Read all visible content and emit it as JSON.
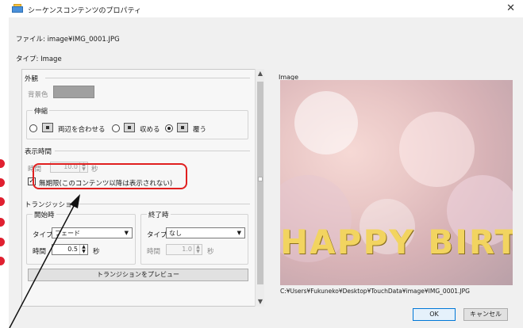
{
  "window": {
    "title": "シーケンスコンテンツのプロパティ",
    "close_glyph": "✕"
  },
  "info": {
    "file": "ファイル:  image¥IMG_0001.JPG",
    "type": "タイプ:  Image"
  },
  "appearance": {
    "title": "外観",
    "bg_color_label": "背景色",
    "stretch_title": "伸縮",
    "options": [
      {
        "label": "両辺を合わせる",
        "icon": "fit-both-icon",
        "selected": false
      },
      {
        "label": "収める",
        "icon": "fit-contain-icon",
        "selected": false
      },
      {
        "label": "覆う",
        "icon": "fit-cover-icon",
        "selected": true
      }
    ]
  },
  "display_time": {
    "title": "表示時間",
    "time_label": "時間",
    "time_value": "10.0",
    "unit": "秒",
    "unlimited_label": "無期限(このコンテンツ以降は表示されない)",
    "unlimited_checked": true
  },
  "transition": {
    "title": "トランジッション",
    "start": {
      "title": "開始時",
      "type_label": "タイプ",
      "type_value": "フェード",
      "time_label": "時間",
      "time_value": "0.5",
      "unit": "秒"
    },
    "end": {
      "title": "終了時",
      "type_label": "タイプ",
      "type_value": "なし",
      "time_label": "時間",
      "time_value": "1.0",
      "unit": "秒"
    },
    "preview_button": "トランジションをプレビュー"
  },
  "preview": {
    "label": "Image",
    "banner": "HAPPY BIRTHDAY",
    "path": "C:¥Users¥Fukuneko¥Desktop¥TouchData¥image¥IMG_0001.JPG"
  },
  "buttons": {
    "ok": "OK",
    "cancel": "キャンセル"
  },
  "colors": {
    "highlight": "#e02020",
    "bg_swatch": "#a0a0a0",
    "accent": "#0078d7"
  }
}
